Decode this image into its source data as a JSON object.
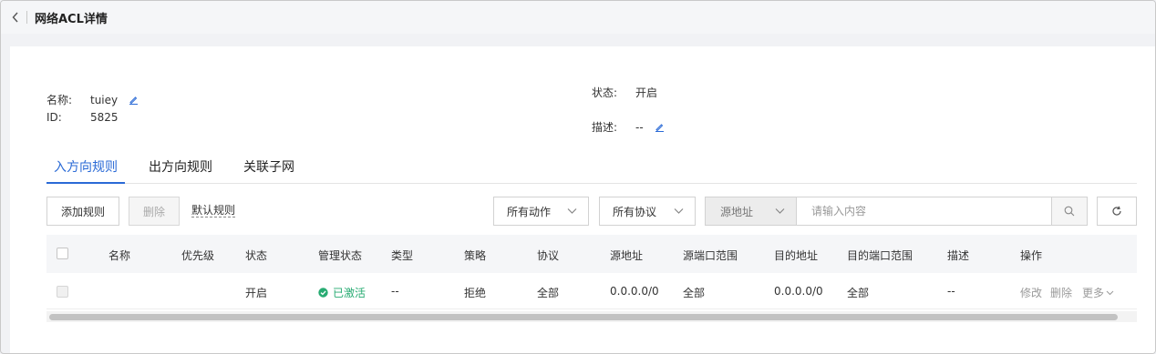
{
  "header": {
    "title": "网络ACL详情"
  },
  "info": {
    "name_label": "名称:",
    "name_value": "tuiey",
    "id_label": "ID:",
    "id_value": "5825",
    "status_label": "状态:",
    "status_value": "开启",
    "desc_label": "描述:",
    "desc_value": "--"
  },
  "tabs": [
    {
      "label": "入方向规则",
      "active": true
    },
    {
      "label": "出方向规则",
      "active": false
    },
    {
      "label": "关联子网",
      "active": false
    }
  ],
  "toolbar": {
    "add_label": "添加规则",
    "delete_label": "删除",
    "default_rules_label": "默认规则",
    "action_filter": "所有动作",
    "protocol_filter": "所有协议",
    "field_select": "源地址",
    "search_placeholder": "请输入内容"
  },
  "table": {
    "columns": [
      "名称",
      "优先级",
      "状态",
      "管理状态",
      "类型",
      "策略",
      "协议",
      "源地址",
      "源端口范围",
      "目的地址",
      "目的端口范围",
      "描述",
      "操作"
    ],
    "rows": [
      {
        "name": "",
        "priority": "",
        "status": "开启",
        "admin_status": "已激活",
        "type": "--",
        "policy": "拒绝",
        "protocol": "全部",
        "src_addr": "0.0.0.0/0",
        "src_port": "全部",
        "dst_addr": "0.0.0.0/0",
        "dst_port": "全部",
        "desc": "--",
        "ops": {
          "edit": "修改",
          "delete": "删除",
          "more": "更多"
        }
      }
    ]
  },
  "colors": {
    "accent": "#2a6ad6",
    "success": "#27ab72",
    "muted": "#9a9a9a"
  }
}
